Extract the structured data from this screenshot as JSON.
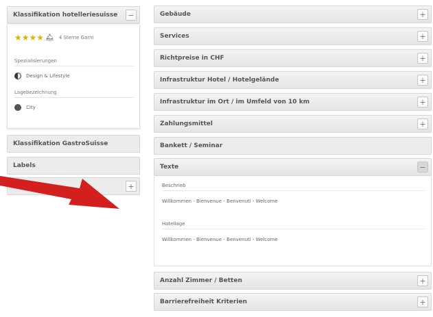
{
  "left": {
    "accordion_main": {
      "title": "Klassifikation hotelleriesuisse",
      "toggle": "−"
    },
    "stars": {
      "count": 4,
      "label": "4 Sterne Garni",
      "star_color": "#e3b000"
    },
    "specializations": {
      "label": "Spezialisierungen",
      "items": [
        {
          "icon": "design-lifestyle-icon",
          "label": "Design & Lifestyle"
        }
      ]
    },
    "location": {
      "label": "Lagebezeichnung",
      "items": [
        {
          "icon": "city-icon",
          "label": "City"
        }
      ]
    },
    "accordion_gastro": {
      "title": "Klassifikation GastroSuisse"
    },
    "accordion_labels": {
      "title": "Labels"
    },
    "accordion_extra": {
      "toggle": "+"
    }
  },
  "right": {
    "sections": [
      {
        "title": "Gebäude",
        "toggle": "+"
      },
      {
        "title": "Services",
        "toggle": "+"
      },
      {
        "title": "Richtpreise in CHF",
        "toggle": "+"
      },
      {
        "title": "Infrastruktur Hotel / Hotelgelände",
        "toggle": "+"
      },
      {
        "title": "Infrastruktur im Ort / im Umfeld von 10 km",
        "toggle": "+"
      },
      {
        "title": "Zahlungsmittel",
        "toggle": "+"
      },
      {
        "title": "Bankett / Seminar",
        "toggle": ""
      },
      {
        "title": "Texte",
        "toggle": "−"
      }
    ],
    "texte": {
      "blocks": [
        {
          "label": "Beschrieb",
          "text": "Willkommen - Bienvenue - Benvenuti - Welcome"
        },
        {
          "label": "Hotellage",
          "text": "Willkommen - Bienvenue - Benvenuti - Welcome"
        }
      ]
    },
    "bottom_sections": [
      {
        "title": "Anzahl Zimmer / Betten",
        "toggle": "+"
      },
      {
        "title": "Barrierefreiheit Kriterien",
        "toggle": "+"
      }
    ]
  },
  "annotation": {
    "arrow_color": "#d41f1f"
  }
}
